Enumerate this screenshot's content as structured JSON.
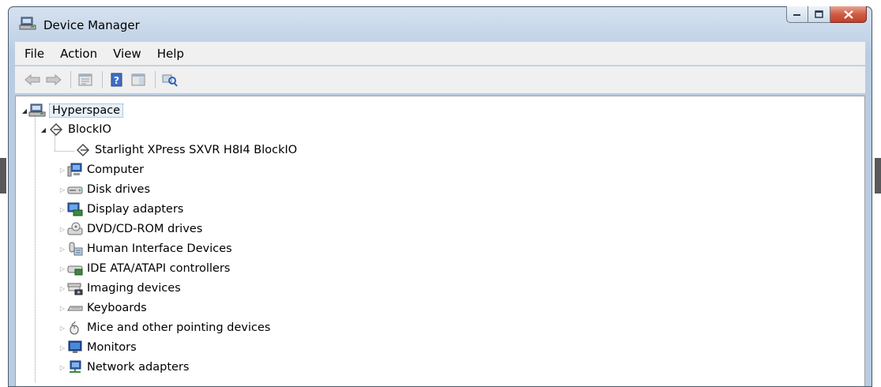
{
  "window": {
    "title": "Device Manager",
    "icon": "device-manager-icon"
  },
  "menu": [
    "File",
    "Action",
    "View",
    "Help"
  ],
  "toolbar": {
    "buttons": [
      "back-arrow-icon",
      "forward-arrow-icon",
      "properties-icon",
      "help-icon",
      "show-hide-tree-icon",
      "scan-hardware-icon"
    ]
  },
  "tree": {
    "root": {
      "label": "Hyperspace",
      "icon": "computer-network-icon",
      "expanded": true
    },
    "expanded_category": {
      "label": "BlockIO",
      "icon": "diamond-connector-icon",
      "expanded": true
    },
    "expanded_child": {
      "label": "Starlight XPress SXVR H8I4 BlockIO",
      "icon": "diamond-connector-icon"
    },
    "categories": [
      {
        "label": "Computer",
        "icon": "computer-icon"
      },
      {
        "label": "Disk drives",
        "icon": "disk-drive-icon"
      },
      {
        "label": "Display adapters",
        "icon": "display-adapter-icon"
      },
      {
        "label": "DVD/CD-ROM drives",
        "icon": "dvd-drive-icon"
      },
      {
        "label": "Human Interface Devices",
        "icon": "hid-icon"
      },
      {
        "label": "IDE ATA/ATAPI controllers",
        "icon": "ide-controller-icon"
      },
      {
        "label": "Imaging devices",
        "icon": "camera-icon"
      },
      {
        "label": "Keyboards",
        "icon": "keyboard-icon"
      },
      {
        "label": "Mice and other pointing devices",
        "icon": "mouse-icon"
      },
      {
        "label": "Monitors",
        "icon": "monitor-icon"
      },
      {
        "label": "Network adapters",
        "icon": "network-adapter-icon"
      }
    ]
  },
  "colors": {
    "title_bar": "#c3d4e8",
    "close_button": "#cf5b44",
    "selection": "#e8f0fa"
  }
}
